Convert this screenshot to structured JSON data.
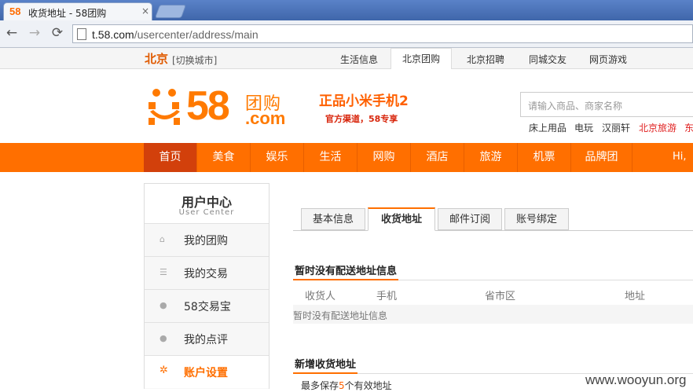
{
  "browser": {
    "tab_favicon": "58",
    "tab_title": "收货地址 - 58团购",
    "tab_close": "×",
    "back": "←",
    "forward": "→",
    "reload": "⟳",
    "url_host": "t.58.com",
    "url_path": "/usercenter/address/main"
  },
  "topbar": {
    "city": "北京",
    "city_switch": "[切换城市]",
    "links": [
      "生活信息",
      "北京团购",
      "北京招聘",
      "同城交友",
      "网页游戏"
    ],
    "active_link": "北京团购"
  },
  "header": {
    "logo_text": "58",
    "logo_tuan": "团购",
    "logo_com": ".com",
    "promo_title": "正品小米手机2",
    "promo_sub": "官方渠道，58专享",
    "search_placeholder": "请输入商品、商家名称",
    "hot_words": [
      "床上用品",
      "电玩",
      "汉丽轩",
      "北京旅游",
      "东"
    ]
  },
  "mainnav": {
    "items": [
      "首页",
      "美食",
      "娱乐",
      "生活",
      "网购",
      "酒店",
      "旅游",
      "机票",
      "品牌团"
    ],
    "active": "首页",
    "greeting": "Hi,"
  },
  "sidebar": {
    "title": "用户中心",
    "subtitle": "User Center",
    "items": [
      {
        "label": "我的团购",
        "icon": "home-icon"
      },
      {
        "label": "我的交易",
        "icon": "list-icon"
      },
      {
        "label": "58交易宝",
        "icon": "wallet-icon"
      },
      {
        "label": "我的点评",
        "icon": "comment-icon"
      },
      {
        "label": "账户设置",
        "icon": "gear-icon"
      }
    ],
    "active": "账户设置"
  },
  "content": {
    "tabs": [
      "基本信息",
      "收货地址",
      "邮件订阅",
      "账号绑定"
    ],
    "active_tab": "收货地址",
    "section1_title": "暂时没有配送地址信息",
    "columns": [
      "收货人",
      "手机",
      "省市区",
      "地址"
    ],
    "empty_text": "暂时没有配送地址信息",
    "section2_title": "新增收货地址",
    "note_prefix": "最多保存",
    "note_count": "5",
    "note_suffix": "个有效地址"
  },
  "watermark": "www.wooyun.org",
  "colors": {
    "brand_orange": "#ff6f00",
    "nav_active": "#d2400b",
    "chrome_blue": "#4d73b8"
  }
}
